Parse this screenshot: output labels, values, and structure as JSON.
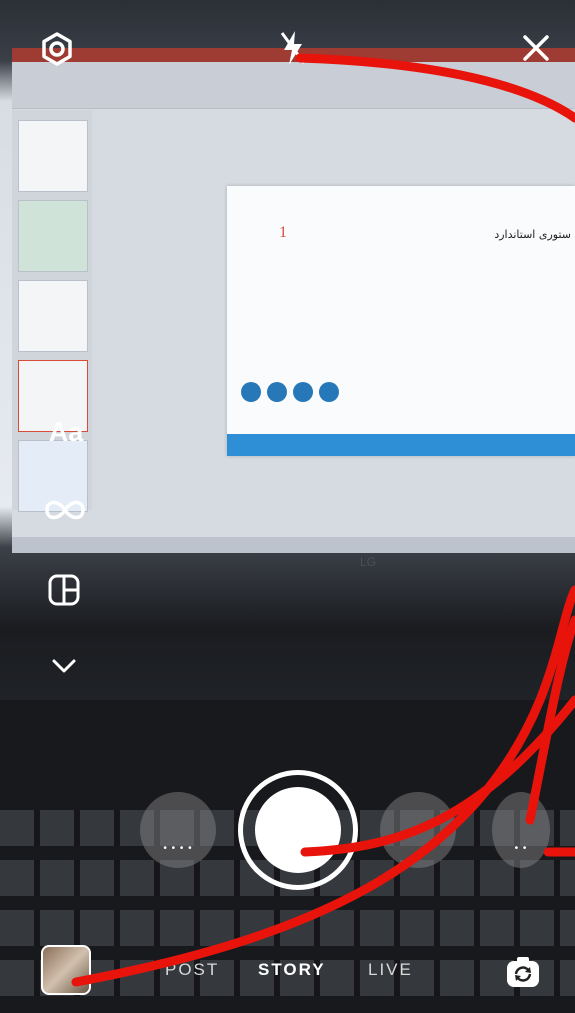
{
  "top_bar": {
    "settings_icon": "gear-icon",
    "flash_icon": "flash-off-icon",
    "close_icon": "close-icon"
  },
  "side_tools": {
    "text_tool_label": "Aa",
    "boomerang_icon": "infinity-icon",
    "layout_icon": "layout-grid-icon",
    "more_icon": "chevron-down-icon"
  },
  "scene": {
    "slide_number": "1",
    "slide_title": "ستوری استاندارد",
    "monitor_brand": "LG"
  },
  "effects": {
    "effect_left_dots": "• • • •",
    "effect_right_dots": "• •"
  },
  "modes": {
    "post": "POST",
    "story": "STORY",
    "live": "LIVE",
    "active": "STORY"
  },
  "bottom": {
    "gallery_icon": "gallery-thumbnail",
    "flip_camera_icon": "flip-camera-icon"
  },
  "colors": {
    "annotation_red": "#e8140c",
    "overlay_white": "#ffffff"
  }
}
